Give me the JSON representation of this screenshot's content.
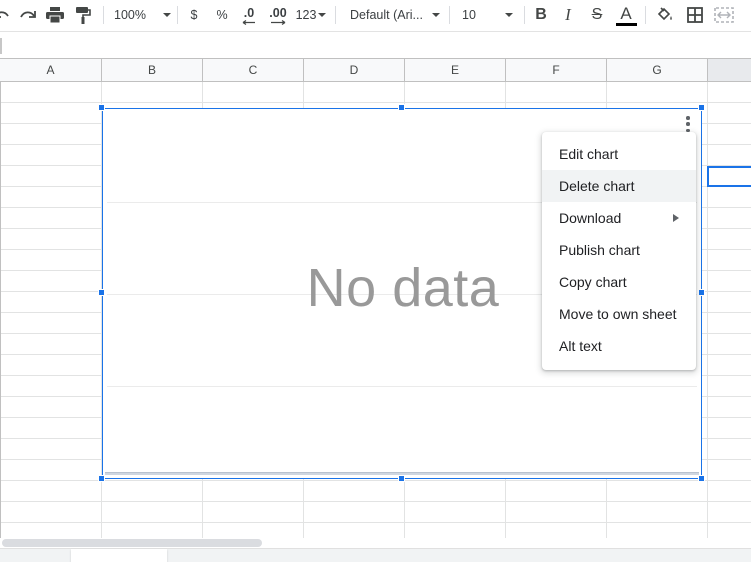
{
  "toolbar": {
    "zoom": "100%",
    "currency": "$",
    "percent": "%",
    "decimal_decrease": ".0",
    "decimal_increase": ".00",
    "number_format": "123",
    "font": "Default (Ari...",
    "font_size": "10",
    "bold": "B",
    "italic": "I",
    "strikethrough": "S",
    "text_color": "A",
    "text_color_value": "#000000"
  },
  "columns": [
    "A",
    "B",
    "C",
    "D",
    "E",
    "F",
    "G"
  ],
  "chart": {
    "empty_message": "No data"
  },
  "menu": {
    "items": [
      {
        "label": "Edit chart"
      },
      {
        "label": "Delete chart"
      },
      {
        "label": "Download"
      },
      {
        "label": "Publish chart"
      },
      {
        "label": "Copy chart"
      },
      {
        "label": "Move to own sheet"
      },
      {
        "label": "Alt text"
      }
    ],
    "hovered_index": 1
  },
  "colors": {
    "accent": "#1a73e8",
    "menu_hover": "#f1f3f4"
  }
}
